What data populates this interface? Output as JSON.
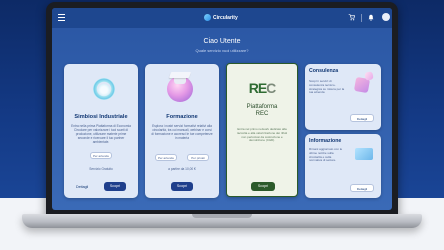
{
  "app": {
    "logo_text": "Circularity"
  },
  "header": {
    "greeting": "Ciao Utente",
    "subtitle": "Quale servizio vuoi utilizzare?"
  },
  "icons": {
    "menu": "hamburger-icon",
    "cart": "cart-icon",
    "bell": "bell-icon",
    "avatar": "avatar"
  },
  "cards": {
    "simbiosi": {
      "title": "Simbiosi Industriale",
      "text": "Entra nella prima Piattaforma di Economia Circolare per valorizzare i tuoi scarti di produzione, utilizzare materie prime seconde e ricercare il tuo partner ambientale.",
      "tag": "Per aziende",
      "note": "Servizio Gratuito",
      "link": "Dettagli",
      "button": "Scopri"
    },
    "formazione": {
      "title": "Formazione",
      "text": "Esplora i nostri servizi formativi relativi alla circolarità, tra cui manuali, webinar e corsi di formazione e accresci le tue competenze in materia",
      "tag1": "Per aziende",
      "tag2": "Per privati",
      "price": "a partire da 10,00 €",
      "button": "Scopri"
    },
    "rec": {
      "logo_main": "RE",
      "logo_c": "C",
      "title_line1": "Piattaforma",
      "title_line2": "REC",
      "text": "Entra nel primo network dedicato alla raccolta e alla valorizzazione dei rifiuti non pericolosi da costruzione e demolizione (C&D).",
      "button": "Scopri"
    },
    "consulenza": {
      "title": "Consulenza",
      "text": "Scopri i servizi di consulenza tecnico-strategica su misura per la tua azienda",
      "button": "Dettagli"
    },
    "informazione": {
      "title": "Informazione",
      "text": "Rimani aggiornato con le ultime notizie sulla circolarità e sulla normativa di settore.",
      "button": "Dettagli"
    }
  },
  "colors": {
    "brand": "#1f3f8c",
    "rec_green": "#2c5a2a",
    "background": "#143a86"
  }
}
